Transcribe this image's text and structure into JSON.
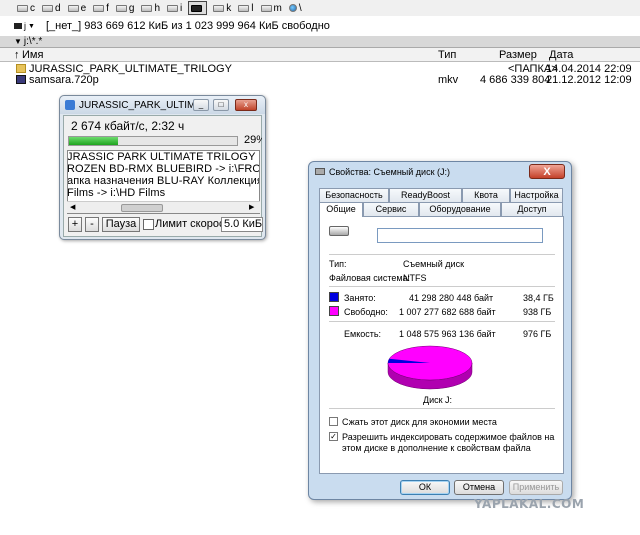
{
  "drive_bar": {
    "drives": [
      {
        "letter": "c",
        "active": false
      },
      {
        "letter": "d",
        "active": false
      },
      {
        "letter": "e",
        "active": false
      },
      {
        "letter": "f",
        "active": false
      },
      {
        "letter": "g",
        "active": false
      },
      {
        "letter": "h",
        "active": false
      },
      {
        "letter": "i",
        "active": false
      },
      {
        "letter": "",
        "active": true
      },
      {
        "letter": "k",
        "active": false
      },
      {
        "letter": "l",
        "active": false
      },
      {
        "letter": "m",
        "active": false
      },
      {
        "letter": "\\",
        "active": false
      }
    ]
  },
  "path_bar": {
    "drive_letter": "j",
    "info": "[_нет_]  983 669 612 КиБ из 1 023 999 964 КиБ свободно"
  },
  "panel": {
    "current_path": "j:\\*.*",
    "columns": {
      "name": "Имя",
      "type": "Тип",
      "size": "Размер",
      "date": "Дата"
    },
    "rows": [
      {
        "name": "JURASSIC_PARK_ULTIMATE_TRILOGY",
        "type": "",
        "size": "<ПАПКА>",
        "date": "14.04.2014 22:09",
        "kind": "folder"
      },
      {
        "name": "samsara.720p",
        "type": "mkv",
        "size": "4 686 339 804",
        "date": "21.12.2012 12:09",
        "kind": "video"
      }
    ]
  },
  "copy_window": {
    "title": "JURASSIC_PARK_ULTIMATE_T...",
    "speed_text": "2 674 кбайт/с, 2:32 ч",
    "progress": 0.29,
    "percent_text": "29%",
    "log_lines": [
      "JRASSIC PARK ULTIMATE TRILOGY ->",
      "ROZEN  BD-RMX  BLUEBIRD -> i:\\FROZEN",
      "апка назначения BLU-RAY Коллекция -",
      "Films -> i:\\HD Films"
    ],
    "buttons": {
      "plus": "+",
      "minus": "-",
      "pause": "Пауза"
    },
    "limit_label": "Лимит скорости",
    "limit_value": "5.0  КиБ"
  },
  "properties": {
    "title": "Свойства: Съемный диск (J:)",
    "close_label": "X",
    "tabs_top": [
      "Безопасность",
      "ReadyBoost",
      "Квота",
      "Настройка"
    ],
    "tabs_bottom": [
      "Общие",
      "Сервис",
      "Оборудование",
      "Доступ"
    ],
    "active_tab": "Общие",
    "name_value": "",
    "type_label": "Тип:",
    "type_value": "Съемный диск",
    "fs_label": "Файловая система:",
    "fs_value": "NTFS",
    "used": {
      "label": "Занято:",
      "bytes": "41 298 280 448 байт",
      "short": "38,4 ГБ",
      "color": "#0000e0",
      "fraction": 0.04
    },
    "free": {
      "label": "Свободно:",
      "bytes": "1 007 277 682 688 байт",
      "short": "938 ГБ",
      "color": "#ff00ff",
      "fraction": 0.96
    },
    "capacity": {
      "label": "Емкость:",
      "bytes": "1 048 575 963 136 байт",
      "short": "976 ГБ"
    },
    "disk_label": "Диск J:",
    "compress_label": "Сжать этот диск для экономии места",
    "compress_checked": false,
    "index_label": "Разрешить индексировать содержимое файлов на этом диске в дополнение к свойствам файла",
    "index_checked": true,
    "buttons": {
      "ok": "ОК",
      "cancel": "Отмена",
      "apply": "Применить"
    }
  },
  "watermark": "YAPLAKAL.COM"
}
